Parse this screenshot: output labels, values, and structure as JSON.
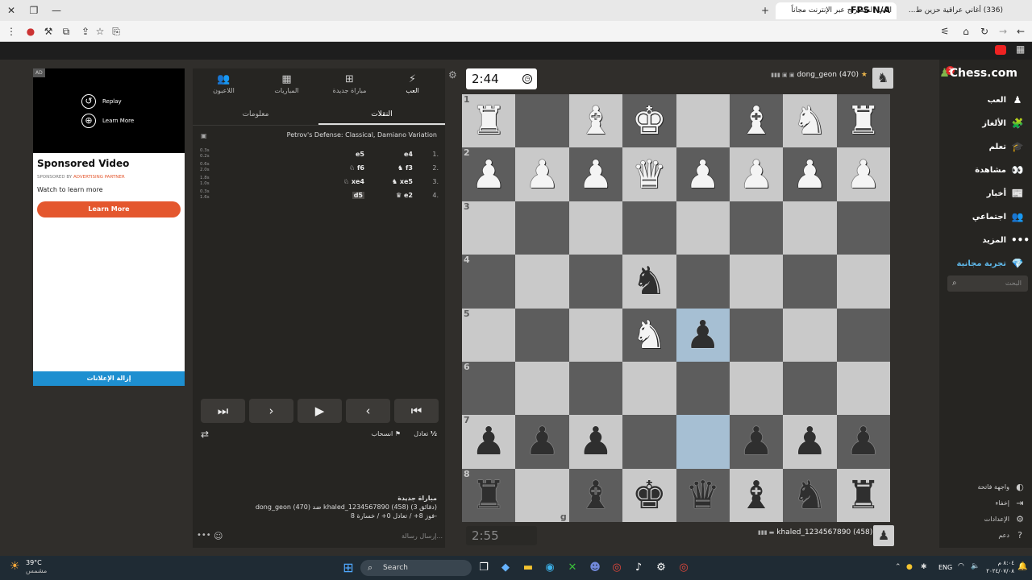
{
  "browser": {
    "tabs": [
      {
        "title": "(336) أغاني عراقية حزين ط...",
        "active": false
      },
      {
        "title": "العب الشطرنج عبر الإنترنت مجاناً",
        "active": true
      }
    ],
    "fps_label": "FPS N/A",
    "url": "chess.com/game/143222440932"
  },
  "ad": {
    "badge": "AD",
    "replay": "Replay",
    "learn_more": "Learn More",
    "title": "Sponsored Video",
    "sponsored_by": "SPONSORED BY",
    "partner": "ADVERTISING PARTNER",
    "subtitle": "Watch to learn more",
    "button": "Learn More",
    "remove_ads": "إزالة الإعلانات"
  },
  "panel": {
    "tabs": [
      {
        "label": "العب",
        "icon": "bolt-icon",
        "glyph": "⚡"
      },
      {
        "label": "مباراة جديدة",
        "icon": "plus-icon",
        "glyph": "⊞"
      },
      {
        "label": "المباريات",
        "icon": "board-icon",
        "glyph": "▦"
      },
      {
        "label": "اللاعبون",
        "icon": "players-icon",
        "glyph": "👥"
      }
    ],
    "subtabs": {
      "moves": "النقلات",
      "info": "معلومات"
    },
    "opening": "Petrov's Defense: Classical, Damiano Variation",
    "moves": [
      {
        "num": "1.",
        "white": "e4",
        "black": "e5",
        "t1": "0.3s",
        "t2": "0.2s"
      },
      {
        "num": "2.",
        "white": "♞ f3",
        "black": "♘ f6",
        "t1": "0.6s",
        "t2": "2.0s"
      },
      {
        "num": "3.",
        "white": "♞ xe5",
        "black": "♘ xe4",
        "t1": "1.8s",
        "t2": "1.0s"
      },
      {
        "num": "4.",
        "white": "♛ e2",
        "black": "d5",
        "t1": "0.3s",
        "t2": "1.6s"
      }
    ],
    "draw": "تعادل",
    "draw_glyph": "½",
    "resign": "انسحاب",
    "new_game_title": "مباراة جديدة",
    "match_line": "dong_geon (470) ضد khaled_1234567890 (458) (3 دقائق)",
    "record_line": "فوز 8+ / تعادل 0+ / خسارة 8-",
    "chat_placeholder": "إرسال رسالة..."
  },
  "game": {
    "top_clock": "2:44",
    "bottom_clock": "2:55",
    "top_player": "dong_geon (470)",
    "bottom_player": "khaled_1234567890 (458)",
    "file_label": "g"
  },
  "board": [
    [
      "wR",
      "",
      "wB",
      "wK",
      "",
      "wB",
      "wN",
      "wR"
    ],
    [
      "wP",
      "wP",
      "wP",
      "wQ",
      "wP",
      "wP",
      "wP",
      "wP"
    ],
    [
      "",
      "",
      "",
      "",
      "",
      "",
      "",
      ""
    ],
    [
      "",
      "",
      "",
      "bN",
      "",
      "",
      "",
      ""
    ],
    [
      "",
      "",
      "",
      "wN",
      "bP",
      "",
      "",
      ""
    ],
    [
      "",
      "",
      "",
      "",
      "",
      "",
      "",
      ""
    ],
    [
      "bP",
      "bP",
      "bP",
      "",
      "",
      "bP",
      "bP",
      "bP"
    ],
    [
      "bR",
      "",
      "bB",
      "bK",
      "bQ",
      "bB",
      "bN",
      "bR"
    ]
  ],
  "highlights": [
    "4-4",
    "6-4"
  ],
  "rank_labels": [
    "1",
    "2",
    "3",
    "4",
    "5",
    "6",
    "7",
    "8"
  ],
  "rightnav": {
    "logo": "Chess.com",
    "items": [
      {
        "label": "العب",
        "icon": "play-icon",
        "glyph": "♟"
      },
      {
        "label": "الألغاز",
        "icon": "puzzle-icon",
        "glyph": "🧩"
      },
      {
        "label": "تعلم",
        "icon": "learn-icon",
        "glyph": "🎓"
      },
      {
        "label": "مشاهدة",
        "icon": "watch-icon",
        "glyph": "👀"
      },
      {
        "label": "أخبار",
        "icon": "news-icon",
        "glyph": "📰"
      },
      {
        "label": "اجتماعي",
        "icon": "social-icon",
        "glyph": "👥"
      },
      {
        "label": "المزيد",
        "icon": "more-icon",
        "glyph": "•••"
      },
      {
        "label": "تجربة مجانية",
        "icon": "diamond-icon",
        "glyph": "💎"
      }
    ],
    "search_placeholder": "البحث",
    "bottom": [
      {
        "label": "واجهة فاتحة",
        "icon": "theme-icon",
        "glyph": "◐"
      },
      {
        "label": "إخفاء",
        "icon": "collapse-icon",
        "glyph": "⇥"
      },
      {
        "label": "الإعدادات",
        "icon": "settings-icon",
        "glyph": "⚙"
      },
      {
        "label": "دعم",
        "icon": "help-icon",
        "glyph": "?"
      }
    ],
    "notif_badge": "2"
  },
  "taskbar": {
    "weather_temp": "39°C",
    "weather_desc": "مشمس",
    "search": "Search",
    "lang": "ENG",
    "time": "٨:٠٤ م",
    "date": "٢٠٢٤/٠٧/٠٨"
  }
}
